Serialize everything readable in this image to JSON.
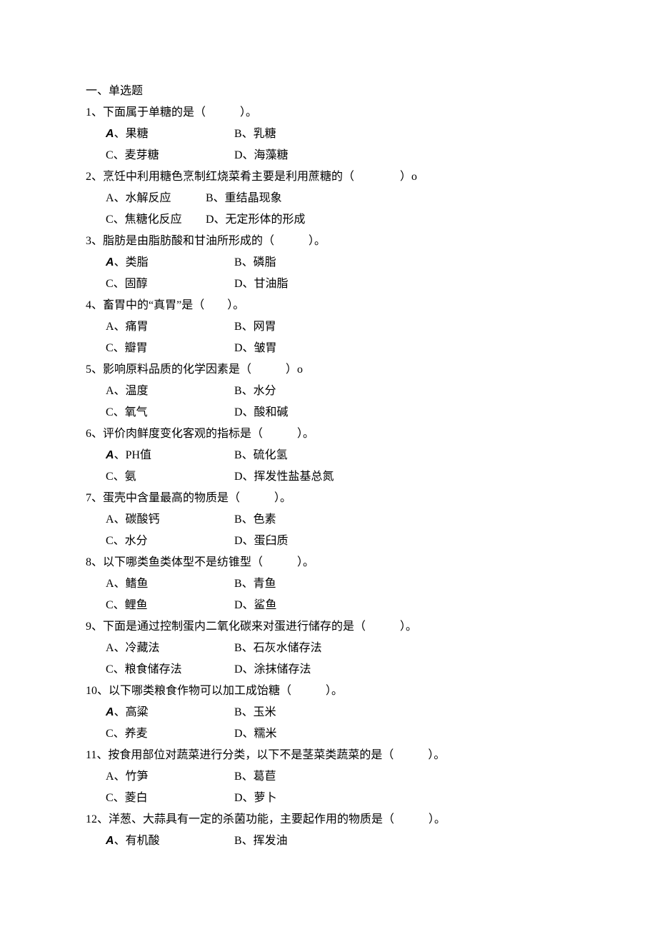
{
  "section_title": "一、单选题",
  "questions": [
    {
      "num": "1、",
      "text": "下面属于单糖的是（　　　）。",
      "rows": [
        {
          "a_lbl": "A、",
          "a_txt": "果糖",
          "a_latin": true,
          "b_lbl": "B、",
          "b_txt": "乳糖"
        },
        {
          "a_lbl": "C、",
          "a_txt": "麦芽糖",
          "a_latin": false,
          "b_lbl": "D、",
          "b_txt": "海藻糖"
        }
      ]
    },
    {
      "num": "2、",
      "text": "烹饪中利用糖色烹制红烧菜肴主要是利用蔗糖的（　　　　）o",
      "rows": [
        {
          "a_lbl": "A、",
          "a_txt": "水解反应",
          "a_latin": false,
          "b_lbl": "B、",
          "b_txt": "重结晶现象",
          "narrow": true
        },
        {
          "a_lbl": "C、",
          "a_txt": "焦糖化反应",
          "a_latin": false,
          "b_lbl": "D、",
          "b_txt": "无定形体的形成",
          "narrow": true
        }
      ]
    },
    {
      "num": "3、",
      "text": "脂肪是由脂肪酸和甘油所形成的（　　　）。",
      "rows": [
        {
          "a_lbl": "A、",
          "a_txt": "类脂",
          "a_latin": true,
          "b_lbl": "B、",
          "b_txt": "磷脂"
        },
        {
          "a_lbl": "C、",
          "a_txt": "固醇",
          "a_latin": false,
          "b_lbl": "D、",
          "b_txt": "甘油脂"
        }
      ]
    },
    {
      "num": "4、",
      "text": "畜胃中的“真胃”是（　　）。",
      "rows": [
        {
          "a_lbl": "A、",
          "a_txt": "痛胃",
          "a_latin": false,
          "b_lbl": "B、",
          "b_txt": "网胃"
        },
        {
          "a_lbl": "C、",
          "a_txt": "瓣胃",
          "a_latin": false,
          "b_lbl": "D、",
          "b_txt": "皱胃"
        }
      ]
    },
    {
      "num": "5、",
      "text": "影响原料品质的化学因素是（　　　）o",
      "rows": [
        {
          "a_lbl": "A、",
          "a_txt": "温度",
          "a_latin": false,
          "b_lbl": "B、",
          "b_txt": "水分"
        },
        {
          "a_lbl": "C、",
          "a_txt": "氧气",
          "a_latin": false,
          "b_lbl": "D、",
          "b_txt": "酸和碱"
        }
      ]
    },
    {
      "num": "6、",
      "text": "评价肉鲜度变化客观的指标是（　　　）。",
      "rows": [
        {
          "a_lbl": "A、",
          "a_txt": "PH值",
          "a_latin": true,
          "b_lbl": "B、",
          "b_txt": "硫化氢"
        },
        {
          "a_lbl": "C、",
          "a_txt": "氨",
          "a_latin": false,
          "b_lbl": "D、",
          "b_txt": "挥发性盐基总氮"
        }
      ]
    },
    {
      "num": "7、",
      "text": "蛋壳中含量最高的物质是（　　　）。",
      "rows": [
        {
          "a_lbl": "A、",
          "a_txt": "碳酸钙",
          "a_latin": false,
          "b_lbl": "B、",
          "b_txt": "色素"
        },
        {
          "a_lbl": "C、",
          "a_txt": "水分",
          "a_latin": false,
          "b_lbl": "D、",
          "b_txt": "蛋臼质"
        }
      ]
    },
    {
      "num": "8、",
      "text": "以下哪类鱼类体型不是纺锥型（　　　）。",
      "rows": [
        {
          "a_lbl": "A、",
          "a_txt": "鳍鱼",
          "a_latin": false,
          "b_lbl": "B、",
          "b_txt": "青鱼"
        },
        {
          "a_lbl": "C、",
          "a_txt": "鲤鱼",
          "a_latin": false,
          "b_lbl": "D、",
          "b_txt": "鲨鱼"
        }
      ]
    },
    {
      "num": "9、",
      "text": "下面是通过控制蛋内二氧化碳来对蛋进行储存的是（　　　）。",
      "rows": [
        {
          "a_lbl": "A、",
          "a_txt": "冷藏法",
          "a_latin": false,
          "b_lbl": "B、",
          "b_txt": "石灰水储存法"
        },
        {
          "a_lbl": "C、",
          "a_txt": "粮食储存法",
          "a_latin": false,
          "b_lbl": "D、",
          "b_txt": "涂抹储存法"
        }
      ]
    },
    {
      "num": "10、",
      "text": "以下哪类粮食作物可以加工成饴糖（　　　）。",
      "rows": [
        {
          "a_lbl": "A、",
          "a_txt": "高粱",
          "a_latin": true,
          "b_lbl": "B、",
          "b_txt": "玉米"
        },
        {
          "a_lbl": "C、",
          "a_txt": "养麦",
          "a_latin": false,
          "b_lbl": "D、",
          "b_txt": "糯米"
        }
      ]
    },
    {
      "num": "11、",
      "text": "按食用部位对蔬菜进行分类，以下不是茎菜类蔬菜的是（　　　）。",
      "rows": [
        {
          "a_lbl": "A、",
          "a_txt": "竹笋",
          "a_latin": false,
          "b_lbl": "B、",
          "b_txt": "葛苣"
        },
        {
          "a_lbl": "C、",
          "a_txt": "菱白",
          "a_latin": false,
          "b_lbl": "D、",
          "b_txt": "萝卜"
        }
      ]
    },
    {
      "num": "12、",
      "text": "洋葱、大蒜具有一定的杀菌功能，主要起作用的物质是（　　　）。",
      "rows": [
        {
          "a_lbl": "A、",
          "a_txt": "有机酸",
          "a_latin": true,
          "b_lbl": "B、",
          "b_txt": "挥发油"
        }
      ]
    }
  ]
}
